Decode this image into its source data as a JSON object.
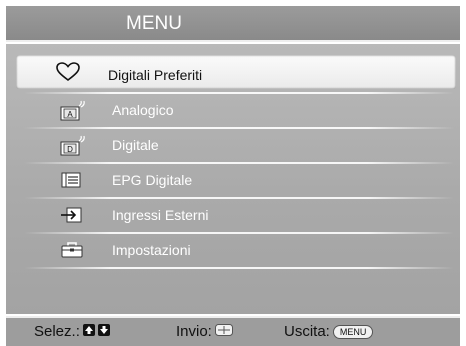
{
  "menu": {
    "title": "MENU",
    "items": [
      {
        "label": "Digitali Preferiti",
        "icon": "heart-icon",
        "selected": true
      },
      {
        "label": "Analogico",
        "icon": "analog-tv-icon",
        "selected": false
      },
      {
        "label": "Digitale",
        "icon": "digital-tv-icon",
        "selected": false
      },
      {
        "label": "EPG Digitale",
        "icon": "epg-list-icon",
        "selected": false
      },
      {
        "label": "Ingressi Esterni",
        "icon": "external-input-icon",
        "selected": false
      },
      {
        "label": "Impostazioni",
        "icon": "toolbox-icon",
        "selected": false
      }
    ]
  },
  "footer": {
    "select_label": "Selez.:",
    "enter_label": "Invio:",
    "exit_label": "Uscita:",
    "menu_key": "MENU"
  },
  "colors": {
    "title_bar": "#8f8f8f",
    "panel": "#adadad",
    "selected_row": "#f4f4f4",
    "footer": "#9d9d9d"
  }
}
